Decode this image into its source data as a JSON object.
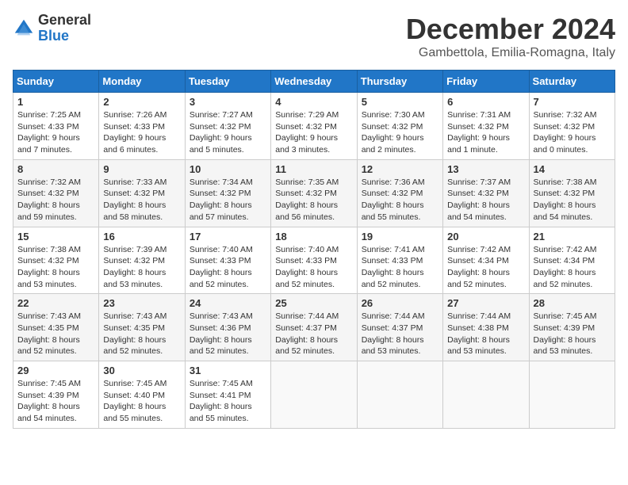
{
  "header": {
    "logo_general": "General",
    "logo_blue": "Blue",
    "title": "December 2024",
    "location": "Gambettola, Emilia-Romagna, Italy"
  },
  "days_of_week": [
    "Sunday",
    "Monday",
    "Tuesday",
    "Wednesday",
    "Thursday",
    "Friday",
    "Saturday"
  ],
  "weeks": [
    [
      {
        "day": 1,
        "info": "Sunrise: 7:25 AM\nSunset: 4:33 PM\nDaylight: 9 hours and 7 minutes."
      },
      {
        "day": 2,
        "info": "Sunrise: 7:26 AM\nSunset: 4:33 PM\nDaylight: 9 hours and 6 minutes."
      },
      {
        "day": 3,
        "info": "Sunrise: 7:27 AM\nSunset: 4:32 PM\nDaylight: 9 hours and 5 minutes."
      },
      {
        "day": 4,
        "info": "Sunrise: 7:29 AM\nSunset: 4:32 PM\nDaylight: 9 hours and 3 minutes."
      },
      {
        "day": 5,
        "info": "Sunrise: 7:30 AM\nSunset: 4:32 PM\nDaylight: 9 hours and 2 minutes."
      },
      {
        "day": 6,
        "info": "Sunrise: 7:31 AM\nSunset: 4:32 PM\nDaylight: 9 hours and 1 minute."
      },
      {
        "day": 7,
        "info": "Sunrise: 7:32 AM\nSunset: 4:32 PM\nDaylight: 9 hours and 0 minutes."
      }
    ],
    [
      {
        "day": 8,
        "info": "Sunrise: 7:32 AM\nSunset: 4:32 PM\nDaylight: 8 hours and 59 minutes."
      },
      {
        "day": 9,
        "info": "Sunrise: 7:33 AM\nSunset: 4:32 PM\nDaylight: 8 hours and 58 minutes."
      },
      {
        "day": 10,
        "info": "Sunrise: 7:34 AM\nSunset: 4:32 PM\nDaylight: 8 hours and 57 minutes."
      },
      {
        "day": 11,
        "info": "Sunrise: 7:35 AM\nSunset: 4:32 PM\nDaylight: 8 hours and 56 minutes."
      },
      {
        "day": 12,
        "info": "Sunrise: 7:36 AM\nSunset: 4:32 PM\nDaylight: 8 hours and 55 minutes."
      },
      {
        "day": 13,
        "info": "Sunrise: 7:37 AM\nSunset: 4:32 PM\nDaylight: 8 hours and 54 minutes."
      },
      {
        "day": 14,
        "info": "Sunrise: 7:38 AM\nSunset: 4:32 PM\nDaylight: 8 hours and 54 minutes."
      }
    ],
    [
      {
        "day": 15,
        "info": "Sunrise: 7:38 AM\nSunset: 4:32 PM\nDaylight: 8 hours and 53 minutes."
      },
      {
        "day": 16,
        "info": "Sunrise: 7:39 AM\nSunset: 4:32 PM\nDaylight: 8 hours and 53 minutes."
      },
      {
        "day": 17,
        "info": "Sunrise: 7:40 AM\nSunset: 4:33 PM\nDaylight: 8 hours and 52 minutes."
      },
      {
        "day": 18,
        "info": "Sunrise: 7:40 AM\nSunset: 4:33 PM\nDaylight: 8 hours and 52 minutes."
      },
      {
        "day": 19,
        "info": "Sunrise: 7:41 AM\nSunset: 4:33 PM\nDaylight: 8 hours and 52 minutes."
      },
      {
        "day": 20,
        "info": "Sunrise: 7:42 AM\nSunset: 4:34 PM\nDaylight: 8 hours and 52 minutes."
      },
      {
        "day": 21,
        "info": "Sunrise: 7:42 AM\nSunset: 4:34 PM\nDaylight: 8 hours and 52 minutes."
      }
    ],
    [
      {
        "day": 22,
        "info": "Sunrise: 7:43 AM\nSunset: 4:35 PM\nDaylight: 8 hours and 52 minutes."
      },
      {
        "day": 23,
        "info": "Sunrise: 7:43 AM\nSunset: 4:35 PM\nDaylight: 8 hours and 52 minutes."
      },
      {
        "day": 24,
        "info": "Sunrise: 7:43 AM\nSunset: 4:36 PM\nDaylight: 8 hours and 52 minutes."
      },
      {
        "day": 25,
        "info": "Sunrise: 7:44 AM\nSunset: 4:37 PM\nDaylight: 8 hours and 52 minutes."
      },
      {
        "day": 26,
        "info": "Sunrise: 7:44 AM\nSunset: 4:37 PM\nDaylight: 8 hours and 53 minutes."
      },
      {
        "day": 27,
        "info": "Sunrise: 7:44 AM\nSunset: 4:38 PM\nDaylight: 8 hours and 53 minutes."
      },
      {
        "day": 28,
        "info": "Sunrise: 7:45 AM\nSunset: 4:39 PM\nDaylight: 8 hours and 53 minutes."
      }
    ],
    [
      {
        "day": 29,
        "info": "Sunrise: 7:45 AM\nSunset: 4:39 PM\nDaylight: 8 hours and 54 minutes."
      },
      {
        "day": 30,
        "info": "Sunrise: 7:45 AM\nSunset: 4:40 PM\nDaylight: 8 hours and 55 minutes."
      },
      {
        "day": 31,
        "info": "Sunrise: 7:45 AM\nSunset: 4:41 PM\nDaylight: 8 hours and 55 minutes."
      },
      null,
      null,
      null,
      null
    ]
  ]
}
